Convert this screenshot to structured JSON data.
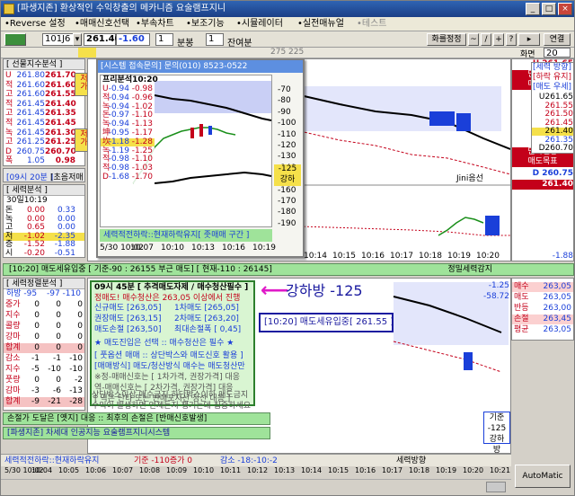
{
  "window": {
    "title": "[파생지존] 환상적인 수익창출의 메카니즘 요술램프지니"
  },
  "menu": [
    "•Reverse 설정",
    "•매매신호선택",
    "•부속차트",
    "•보조기능",
    "•시뮬레이터",
    "•실전매뉴얼",
    "•테스트"
  ],
  "toolbar": {
    "code": "101J6",
    "price": "261.40",
    "change": "-1.60",
    "period": "1",
    "period_unit": "분봉",
    "count": "1",
    "count_unit": "잔여분",
    "ruler": "화를정정",
    "tools": [
      "~",
      "/",
      "+",
      "?"
    ],
    "zoom_label": "화면",
    "zoom": "20",
    "status_strip": "275 225"
  },
  "left": {
    "futures_header": "[ 선물지수분석 ]",
    "futures_rows": [
      {
        "l": "U",
        "a": "261.80",
        "b": "261.70"
      },
      {
        "l": "적",
        "a": "261.60",
        "b": "261.60"
      },
      {
        "l": "고",
        "a": "261.60",
        "b": "261.55"
      },
      {
        "l": "적",
        "a": "261.45",
        "b": "261.40"
      },
      {
        "l": "고",
        "a": "261.45",
        "b": "261.35"
      },
      {
        "l": "적",
        "a": "261.45",
        "b": "261.45"
      },
      {
        "l": "녹",
        "a": "261.45",
        "b": "261.30"
      },
      {
        "l": "고",
        "a": "261.25",
        "b": "261.25"
      },
      {
        "l": "D",
        "a": "260.75",
        "b": "260.70"
      },
      {
        "l": "폭",
        "a": "1.05",
        "b": "0.98"
      }
    ],
    "side_tags": [
      "저가",
      "저가"
    ],
    "analysis_label": "[09시 20분 ]",
    "analysis_sub": "[초음저매매]",
    "trend_header": "[ 세력분석 ]",
    "trend_time": "30일10:19",
    "trend_rows": [
      {
        "l": "돈",
        "a": "0.00",
        "b": "0.33"
      },
      {
        "l": "녹",
        "a": "0.00",
        "b": "0.00"
      },
      {
        "l": "고",
        "a": "0.65",
        "b": "0.00"
      },
      {
        "l": "저",
        "a": "-1.02",
        "b": "-2.35"
      },
      {
        "l": "증",
        "a": "-1.52",
        "b": "-1.88"
      },
      {
        "l": "시",
        "a": "-0.20",
        "b": "-0.51"
      }
    ],
    "force_header": "[ 세력정렬분석 ]",
    "force_sub": [
      "하방 -95",
      "-97 -110"
    ],
    "force_rows": [
      {
        "l": "중가",
        "a": "0",
        "b": "0",
        "c": "0"
      },
      {
        "l": "지수",
        "a": "0",
        "b": "0",
        "c": "0"
      },
      {
        "l": "콜량",
        "a": "0",
        "b": "0",
        "c": "0"
      },
      {
        "l": "강마",
        "a": "0",
        "b": "0",
        "c": "0"
      },
      {
        "l": "합계",
        "a": "0",
        "b": "0",
        "c": "0"
      },
      {
        "l": "감소",
        "a": "-1",
        "b": "-1",
        "c": "-10"
      },
      {
        "l": "지수",
        "a": "-5",
        "b": "-10",
        "c": "-10"
      },
      {
        "l": "풋량",
        "a": "0",
        "b": "0",
        "c": "-2"
      },
      {
        "l": "감마",
        "a": "-3",
        "c": "-13",
        "b": "-6"
      },
      {
        "l": "합계",
        "a": "-9",
        "b": "-21",
        "c": "-28"
      }
    ]
  },
  "popup": {
    "title": "[시스템 접속문의] 문의(010) 8523-0522",
    "header": "프리분석10:20",
    "rows": [
      {
        "l": "U",
        "a": "-0.94",
        "b": "-0.98"
      },
      {
        "l": "적",
        "a": "-0.94",
        "b": "-0.96"
      },
      {
        "l": "녹",
        "a": "-0.94",
        "b": "-1.02"
      },
      {
        "l": "돈",
        "a": "-0.97",
        "b": "-1.10"
      },
      {
        "l": "녹",
        "a": "-0.94",
        "b": "-1.13"
      },
      {
        "l": "坤",
        "a": "-0.95",
        "b": "-1.17"
      },
      {
        "l": "坎",
        "a": "-1.18",
        "b": "-1.28"
      },
      {
        "l": "녹",
        "a": "-1.19",
        "b": "-1.25"
      },
      {
        "l": "적",
        "a": "-0.98",
        "b": "-1.10"
      },
      {
        "l": "적",
        "a": "-0.98",
        "b": "-1.03"
      },
      {
        "l": "D",
        "a": "-1.68",
        "b": "-1.70"
      }
    ],
    "yticks": [
      "-70",
      "-80",
      "-90",
      "-100",
      "-110",
      "-120",
      "-130",
      "-140",
      "-150",
      "-160",
      "-170",
      "-180",
      "-190"
    ],
    "side_value": "-125",
    "side_label": "강하",
    "status_text": "세력적전하락::현재하락유지[ 좃매매 구간 ]",
    "xlabels": [
      "5/30 10:02",
      "10:07",
      "10:10",
      "10:13",
      "10:16",
      "10:19"
    ]
  },
  "main_top": {
    "title": "Jini음선",
    "xlabels": [
      "10:14",
      "10:15",
      "10:16",
      "10:17",
      "10:18",
      "10:19",
      "10:20"
    ]
  },
  "right": {
    "u_label": "U 261.65",
    "top_tag1": "단타진용",
    "top_tag2": "매수목표",
    "bottom_tag1": "단타진용",
    "bottom_tag2": "매도목표",
    "d_label": "D 260.75",
    "current": "261.40",
    "force_box_header": "[세력 방향]",
    "force_box_sub": "[하락 유지]",
    "force_box_sub2": "[매도 우세]",
    "force_levels": [
      "U261.65",
      "261.55",
      "261.50",
      "261.45",
      "261.40",
      "261.35",
      "D260.70"
    ],
    "mid_value": "-1.88"
  },
  "banner1": {
    "text": "[10:20] 매도세유입중 [ 기준-90 : 26155 부근 매도] [ 현재-110 : 26145]",
    "right": "정밀세력감지"
  },
  "bottom": {
    "box_title": "09시 45분 [ 추격매도자제 / 매수청산필수 ]",
    "price_text": "정매도! 매수청산은 263,05 이상에서 진행",
    "price_rows": [
      {
        "l": "신규매도 [263,05]",
        "r": "1차매도 [265,05]"
      },
      {
        "l": "권장매도 [263,15]",
        "r": "2차매도 [263,20]"
      },
      {
        "l": "매도손절 [263,50]",
        "r": "최대손절폭 [ 0,45]"
      }
    ],
    "action_text": "★ 매도진입은 선택  :: 매수청산은 필수 ★",
    "warn1": "[ 풋옵션 매매 :: 상단박스와 매도신호 활용 ]",
    "warn2": "[매매방식] 매도/청산방식 매수는 매도청산만",
    "rule1": "※정-매매신호는 [ 1차가격, 권장가격] 대응",
    "rule2": "역-매매신호는 [ 2차가격, 권장가격] 대응",
    "rule3": "[ 역은 단타 또는 반매포지션 청산 대응 ]",
    "desc1": "상단박스이상 매수금지  하단박스이하 매도금지",
    "desc2": "수익이 발생하면 언제든지 챙기는데 집중하세요",
    "callout_main": "강하방 -125",
    "callout_sub": "[10:20] 매도세유입중[ 261.55 ]",
    "stop_text": "손절가 도달은 [옛지] 대응 :: 최후의 손절은 [반매신호발생]",
    "brand_text": "[파생지존] 차세대 인공지능 요술램프지니시스템",
    "right_vals": [
      "-1.25",
      "-58.72"
    ],
    "right_box": [
      {
        "l": "매수",
        "v": "263,05"
      },
      {
        "l": "매도",
        "v": "263,05"
      },
      {
        "l": "반등",
        "v": "263,00"
      },
      {
        "l": "손절",
        "v": "263,45"
      },
      {
        "l": "평균",
        "v": "263,05"
      }
    ],
    "base_label": "기준",
    "base_val": "-125",
    "base_sub": "강하방",
    "xlabels": [
      "5/30 10:02",
      "10:04",
      "10:05",
      "10:06",
      "10:07",
      "10:08",
      "10:09",
      "10:10",
      "10:11",
      "10:12",
      "10:13",
      "10:14",
      "10:15",
      "10:16",
      "10:17",
      "10:18",
      "10:19",
      "10:20",
      "10:21"
    ]
  },
  "statusbar": {
    "left": "세력적전하락::현재하락유지",
    "mid1": "기준 -110증가 0",
    "mid2": "감소 -18:-10:-2",
    "right": "세력방향",
    "button": "AutoMatic"
  },
  "colors": {
    "up": "#d4001a",
    "down": "#1a3fd9",
    "highlight": "#f5e04a",
    "panel_green": "#9fe39a"
  }
}
